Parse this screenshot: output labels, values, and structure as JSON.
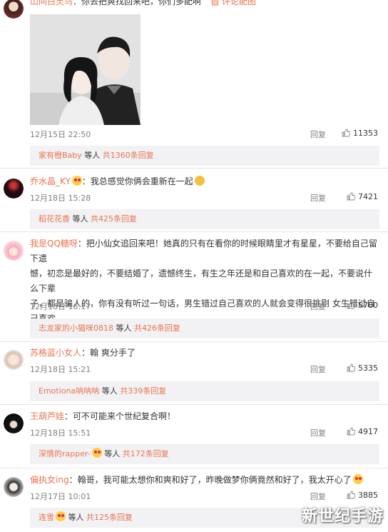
{
  "comments": [
    {
      "user": "山间白灵鸟",
      "text": "：你去把爽找回来吧，你们多配啊",
      "image_link": "评论配图",
      "time": "12月15日 22:50",
      "reply": "回复",
      "likes": "11353",
      "sub_user": "家有橙Baby",
      "sub_mid": " 等人 ",
      "sub_count": "共1360条回复"
    },
    {
      "user": "乔水晶_KY",
      "text": "：我总感觉你俩会重新在一起",
      "time": "12月18日 15:28",
      "reply": "回复",
      "likes": "7421",
      "sub_user": "稻花花香",
      "sub_mid": " 等人 ",
      "sub_count": "共425条回复"
    },
    {
      "user": "我是QQ糖呀",
      "text_lines": [
        "：把小仙女追回来吧！她真的只有在看你的时候眼睛里才有星星，不要给自己留下遗",
        "憾，初恋是最好的，不要结婚了，遗憾终生，有生之年还是和自己喜欢的在一起，不要说什么下辈",
        "子，都是骗人的，你有没有听过一句话，男生错过自己喜欢的人就会变得很挑剔 女生错过自己喜欢",
        "的人就会变得很随意"
      ],
      "time": "12月18日 16:17",
      "reply": "回复",
      "likes": "5700",
      "sub_user": "志龙家的小猫咪0818",
      "sub_mid": " 等人 ",
      "sub_count": "共426条回复"
    },
    {
      "user": "苏格蓝小女人",
      "text": "：翰 爽分手了",
      "time": "12月18日 15:21",
      "reply": "回复",
      "likes": "5335",
      "sub_user": "Emotiona呐呐呐",
      "sub_mid": " 等人 ",
      "sub_count": "共339条回复"
    },
    {
      "user": "王葫芦娃",
      "text": "：可不可能来个世纪复合啊！",
      "time": "12月18日 15:51",
      "reply": "回复",
      "likes": "4917",
      "sub_user": "深情的rapper-",
      "sub_mid": " 等人 ",
      "sub_count": "共172条回复"
    },
    {
      "user": "偏执女ing",
      "text": "：翰哥，我可能太想你和爽和好了，昨晚做梦你俩竟然和好了，我太开心了",
      "time": "12月17日 10:01",
      "reply": "回复",
      "likes": "3885",
      "sub_user": "连雪",
      "sub_mid": " 等人 ",
      "sub_count": "共125条回复"
    }
  ],
  "watermark": "新世纪手游",
  "colors": {
    "accent": "#eb7350",
    "sub_bg": "#f2f2f5",
    "meta": "#808080"
  }
}
